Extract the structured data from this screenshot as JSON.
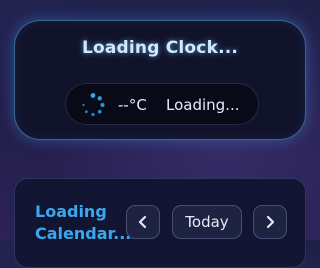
{
  "clock": {
    "title": "Loading Clock...",
    "temperature": "--°C",
    "weather_status": "Loading..."
  },
  "calendar": {
    "title": "Loading Calendar...",
    "today_label": "Today",
    "prev_icon": "chevron-left-icon",
    "next_icon": "chevron-right-icon"
  },
  "colors": {
    "accent": "#3aa8ee",
    "spinner": "#2aa8f0",
    "card_border_glow": "#5aaae6"
  }
}
